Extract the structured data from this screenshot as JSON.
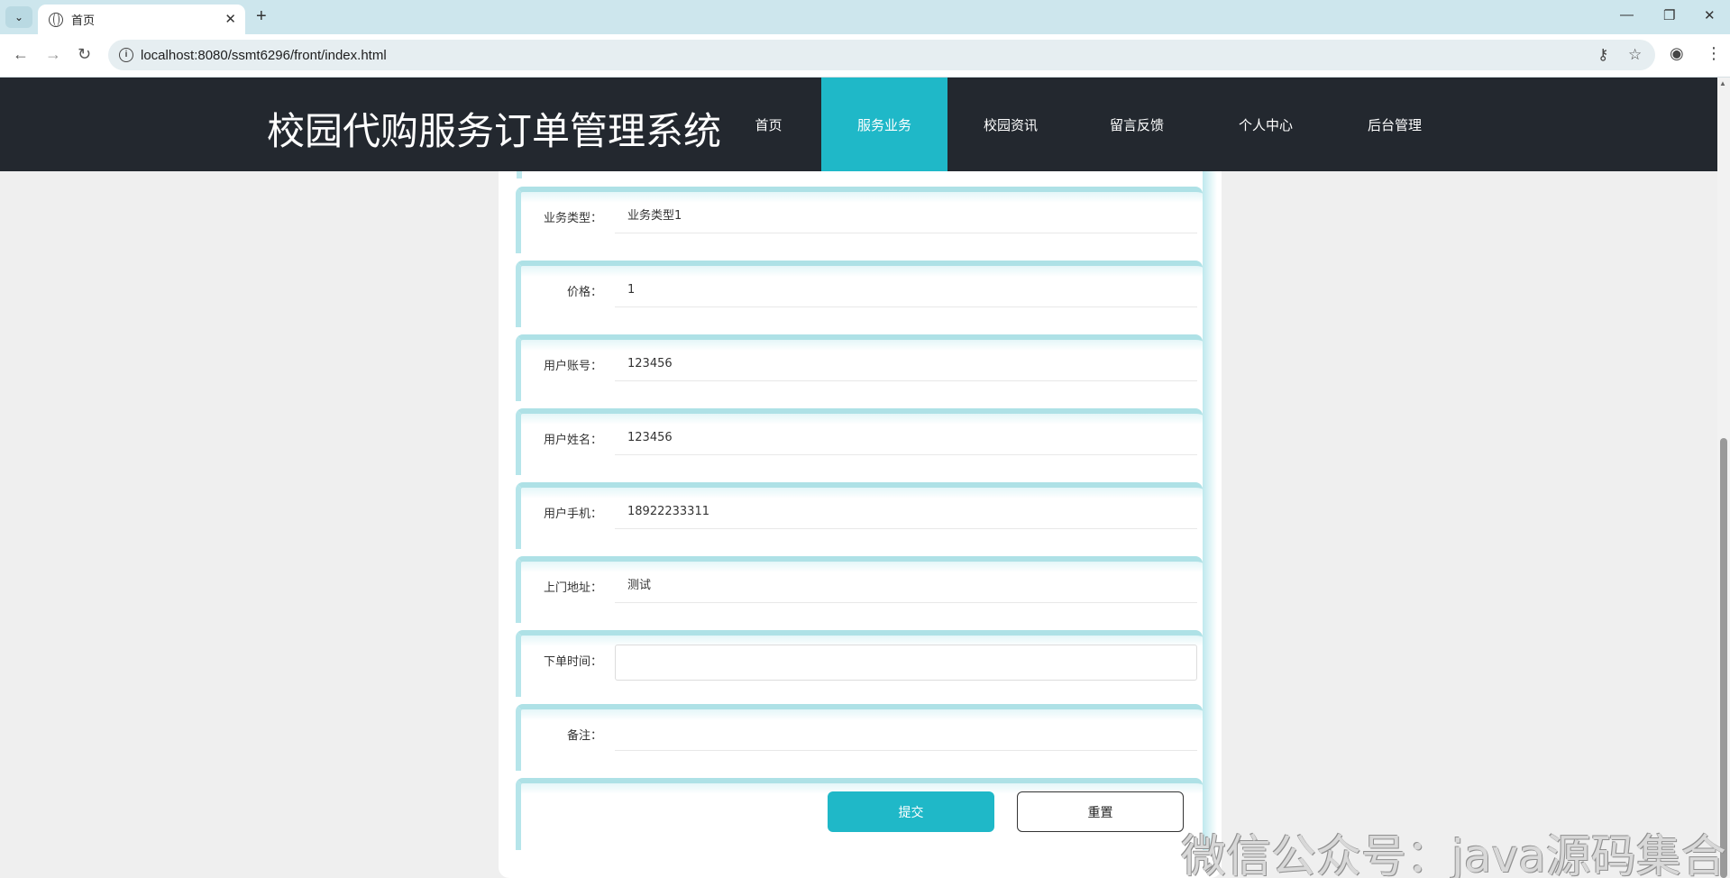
{
  "browser": {
    "tab_title": "首页",
    "url": "localhost:8080/ssmt6296/front/index.html",
    "icons": [
      "tab-search-icon",
      "globe-icon",
      "close-icon",
      "new-tab-icon",
      "minimize-icon",
      "restore-icon",
      "window-close-icon",
      "back-icon",
      "forward-icon",
      "reload-icon",
      "site-info-icon",
      "password-key-icon",
      "bookmark-star-icon",
      "profile-icon",
      "menu-icon"
    ]
  },
  "header": {
    "title": "校园代购服务订单管理系统",
    "nav": [
      {
        "label": "首页",
        "active": false
      },
      {
        "label": "服务业务",
        "active": true
      },
      {
        "label": "校园资讯",
        "active": false
      },
      {
        "label": "留言反馈",
        "active": false
      },
      {
        "label": "个人中心",
        "active": false
      },
      {
        "label": "后台管理",
        "active": false
      }
    ],
    "accent_color": "#1fb8c8",
    "background_color": "#23282f"
  },
  "form": {
    "fields": [
      {
        "label": "业务类型：",
        "value": "业务类型1"
      },
      {
        "label": "价格：",
        "value": "1"
      },
      {
        "label": "用户账号：",
        "value": "123456"
      },
      {
        "label": "用户姓名：",
        "value": "123456"
      },
      {
        "label": "用户手机：",
        "value": "18922233311"
      },
      {
        "label": "上门地址：",
        "value": "测试"
      },
      {
        "label": "下单时间：",
        "value": ""
      },
      {
        "label": "备注：",
        "value": ""
      }
    ],
    "submit_label": "提交",
    "reset_label": "重置"
  },
  "watermark": "微信公众号：java源码集合"
}
